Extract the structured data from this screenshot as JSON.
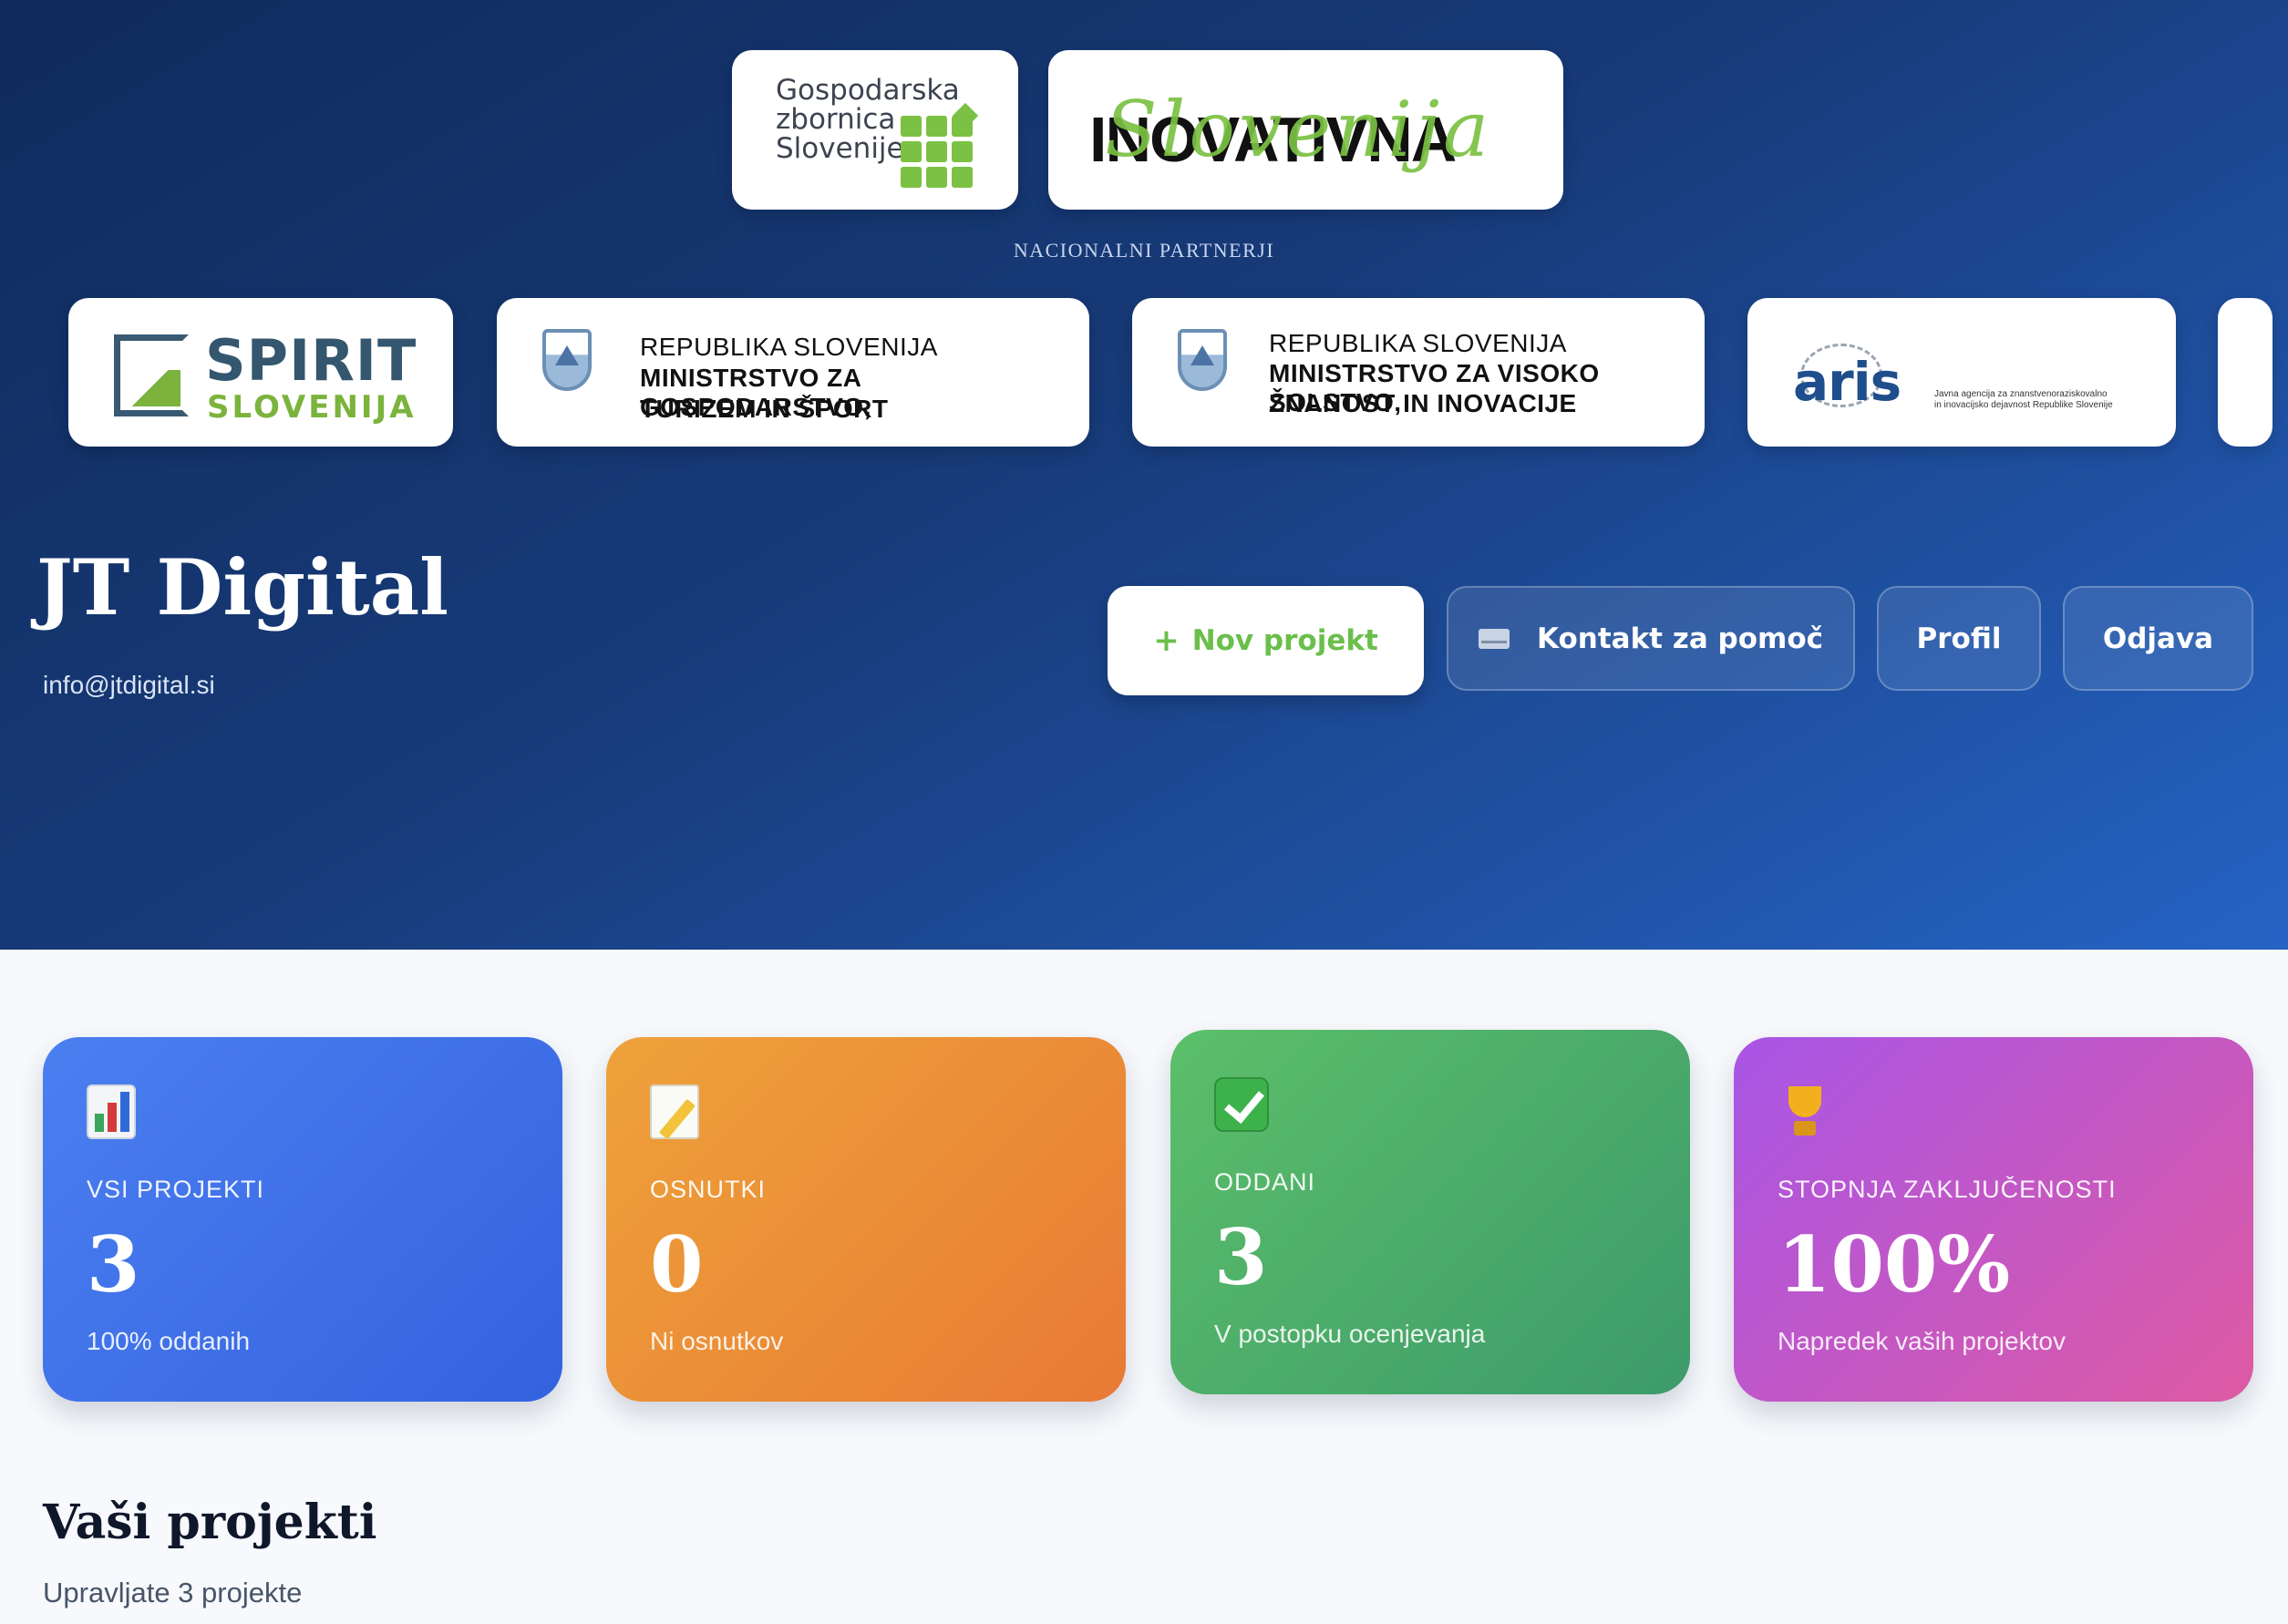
{
  "partners": {
    "top_logos": {
      "gzs": {
        "line1": "Gospodarska",
        "line2": "zbornica",
        "line3": "Slovenije"
      },
      "inovativna": {
        "word": "INOVATIVNA",
        "script": "Slovenija"
      }
    },
    "label": "NACIONALNI PARTNERJI",
    "spirit": {
      "title": "SPIRIT",
      "subtitle": "SLOVENIJA"
    },
    "ministry1": {
      "line1": "REPUBLIKA SLOVENIJA",
      "line2": "MINISTRSTVO ZA GOSPODARSTVO,",
      "line3": "TURIZEM IN ŠPORT"
    },
    "ministry2": {
      "line1": "REPUBLIKA SLOVENIJA",
      "line2": "MINISTRSTVO ZA VISOKO ŠOLSTVO,",
      "line3": "ZNANOST IN INOVACIJE"
    },
    "aris": {
      "word": "aris",
      "small1": "Javna agencija za znanstvenoraziskovalno",
      "small2": "in inovacijsko dejavnost Republike Slovenije"
    }
  },
  "header": {
    "company": "JT Digital",
    "email": "info@jtdigital.si",
    "buttons": {
      "new_project": "Nov projekt",
      "new_project_icon": "+",
      "help": "Kontakt za pomoč",
      "profile": "Profil",
      "logout": "Odjava"
    }
  },
  "stats": [
    {
      "icon": "bar-chart-icon",
      "label": "VSI PROJEKTI",
      "value": "3",
      "sub": "100% oddanih",
      "color": "#3f6fe6"
    },
    {
      "icon": "memo-icon",
      "label": "OSNUTKI",
      "value": "0",
      "sub": "Ni osnutkov",
      "color": "#ec8f37"
    },
    {
      "icon": "check-mark-icon",
      "label": "ODDANI",
      "value": "3",
      "sub": "V postopku ocenjevanja",
      "color": "#4cae69"
    },
    {
      "icon": "trophy-icon",
      "label": "STOPNJA ZAKLJUČENOSTI",
      "value": "100%",
      "sub": "Napredek vaših projektov",
      "color": "#c257c9"
    }
  ],
  "projects": {
    "title": "Vaši projekti",
    "subtitle": "Upravljate 3 projekte"
  }
}
